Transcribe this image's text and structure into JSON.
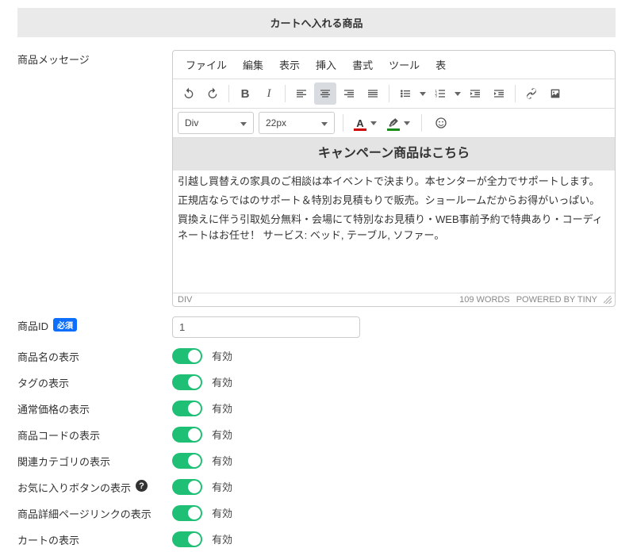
{
  "section_header": "カートへ入れる商品",
  "labels": {
    "product_message": "商品メッセージ",
    "product_id": "商品ID",
    "show_name": "商品名の表示",
    "show_tag": "タグの表示",
    "show_price": "通常価格の表示",
    "show_code": "商品コードの表示",
    "show_category": "関連カテゴリの表示",
    "show_favorite": "お気に入りボタンの表示",
    "show_detail_link": "商品詳細ページリンクの表示",
    "show_cart": "カートの表示",
    "required": "必須",
    "enabled": "有効"
  },
  "editor": {
    "menus": {
      "file": "ファイル",
      "edit": "編集",
      "view": "表示",
      "insert": "挿入",
      "format": "書式",
      "tools": "ツール",
      "table": "表"
    },
    "format_select": "Div",
    "fontsize_select": "22px",
    "status_path": "DIV",
    "word_count": "109 WORDS",
    "powered": "POWERED BY TINY",
    "content": {
      "heading": "キャンペーン商品はこちら",
      "p1": "引越し買替えの家具のご相談は本イベントで決まり。本センターが全力でサポートします。",
      "p2": "正規店ならではのサポート＆特別お見積もりで販売。ショールームだからお得がいっぱい。",
      "p3": "買換えに伴う引取処分無料・会場にて特別なお見積り・WEB事前予約で特典あり・コーディネートはお任せ！ サービス: ベッド, テーブル, ソファー。"
    }
  },
  "product_id_value": "1"
}
